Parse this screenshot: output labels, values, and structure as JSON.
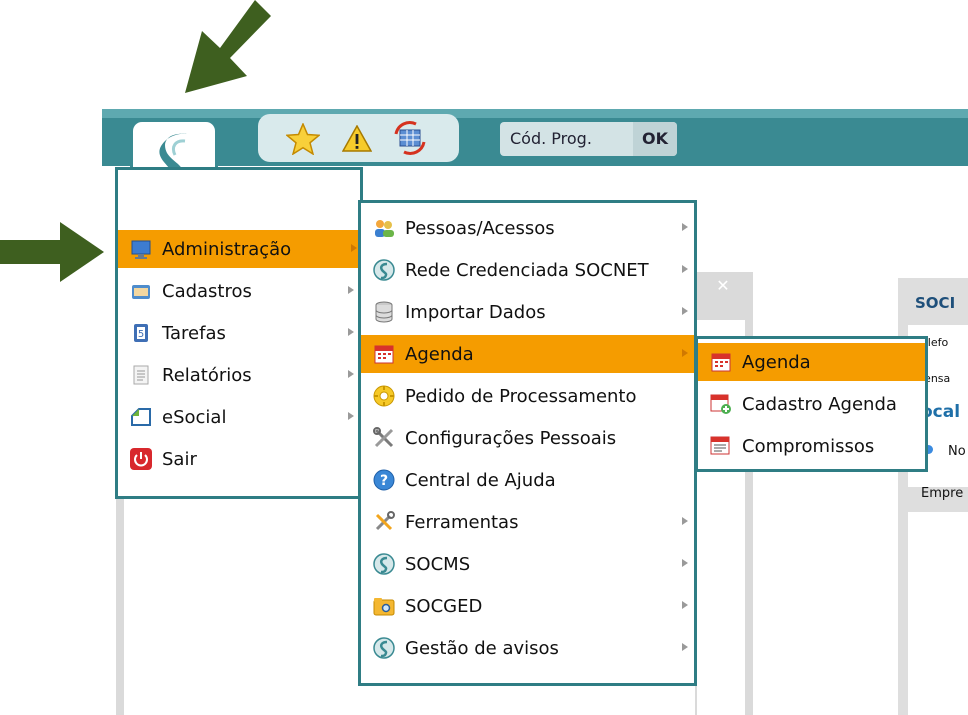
{
  "toolbar": {
    "prog_label": "Cód. Prog.",
    "ok_label": "OK"
  },
  "main_menu": [
    {
      "label": "Administração",
      "icon": "monitor-icon",
      "active": true,
      "has_submenu": true
    },
    {
      "label": "Cadastros",
      "icon": "folder-icon",
      "has_submenu": true
    },
    {
      "label": "Tarefas",
      "icon": "tasks-icon",
      "has_submenu": true
    },
    {
      "label": "Relatórios",
      "icon": "report-icon",
      "has_submenu": true
    },
    {
      "label": "eSocial",
      "icon": "esocial-icon",
      "has_submenu": true
    },
    {
      "label": "Sair",
      "icon": "power-icon",
      "has_submenu": false
    }
  ],
  "admin_submenu": [
    {
      "label": "Pessoas/Acessos",
      "icon": "people-icon",
      "has_submenu": true
    },
    {
      "label": "Rede Credenciada SOCNET",
      "icon": "soc-logo-icon",
      "has_submenu": true
    },
    {
      "label": "Importar Dados",
      "icon": "database-icon",
      "has_submenu": true
    },
    {
      "label": "Agenda",
      "icon": "calendar-icon",
      "active": true,
      "has_submenu": true
    },
    {
      "label": "Pedido de Processamento",
      "icon": "gear-icon",
      "has_submenu": false
    },
    {
      "label": "Configurações Pessoais",
      "icon": "tools-icon",
      "has_submenu": false
    },
    {
      "label": "Central de Ajuda",
      "icon": "help-icon",
      "has_submenu": false
    },
    {
      "label": "Ferramentas",
      "icon": "wrench-icon",
      "has_submenu": true
    },
    {
      "label": "SOCMS",
      "icon": "soc-logo-icon",
      "has_submenu": true
    },
    {
      "label": "SOCGED",
      "icon": "folder-search-icon",
      "has_submenu": true
    },
    {
      "label": "Gestão de avisos",
      "icon": "soc-logo-icon",
      "has_submenu": true
    }
  ],
  "agenda_submenu": [
    {
      "label": "Agenda",
      "icon": "calendar-icon",
      "active": true
    },
    {
      "label": "Cadastro Agenda",
      "icon": "calendar-add-icon"
    },
    {
      "label": "Compromissos",
      "icon": "calendar-list-icon"
    }
  ],
  "right_panel": {
    "title": "SOCI",
    "line1": "elefo",
    "line2": "lensa",
    "line3": "ocal",
    "line4": "No",
    "line5": "Empre"
  },
  "colors": {
    "topbar": "#3a8a92",
    "menu_border": "#2f7d84",
    "active": "#f59c00",
    "arrow_annotation": "#3e5f1f"
  }
}
